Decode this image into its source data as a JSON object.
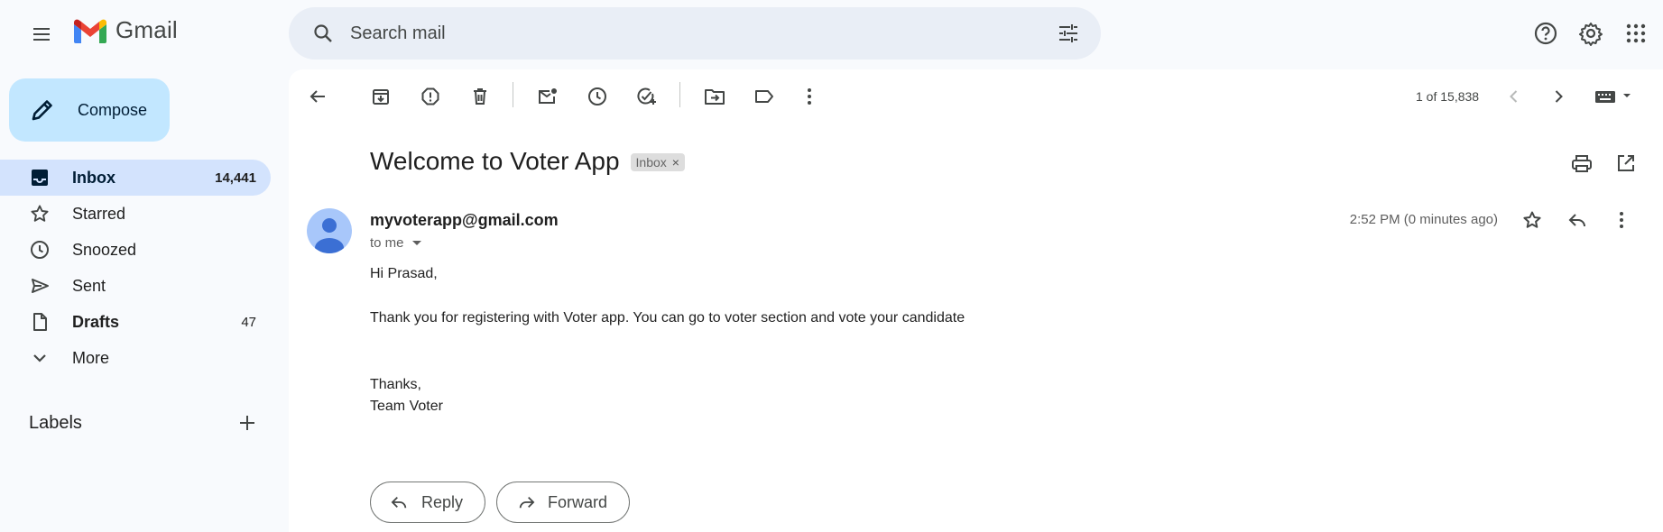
{
  "app": {
    "name": "Gmail"
  },
  "search": {
    "placeholder": "Search mail"
  },
  "compose": {
    "label": "Compose"
  },
  "sidebar": {
    "items": [
      {
        "label": "Inbox",
        "count": "14,441",
        "icon": "inbox-icon"
      },
      {
        "label": "Starred",
        "count": "",
        "icon": "star-icon"
      },
      {
        "label": "Snoozed",
        "count": "",
        "icon": "clock-icon"
      },
      {
        "label": "Sent",
        "count": "",
        "icon": "send-icon"
      },
      {
        "label": "Drafts",
        "count": "47",
        "icon": "draft-icon"
      },
      {
        "label": "More",
        "count": "",
        "icon": "chevron-down-icon"
      }
    ],
    "labels_heading": "Labels"
  },
  "toolbar": {
    "pager": "1 of 15,838"
  },
  "email": {
    "subject": "Welcome to Voter App",
    "label_chip": "Inbox",
    "label_chip_close": "×",
    "sender": "myvoterapp@gmail.com",
    "recipient": "to me",
    "timestamp": "2:52 PM (0 minutes ago)",
    "greeting": "Hi Prasad,",
    "message": "Thank you for registering with Voter app. You can go to voter section and vote your candidate",
    "signoff": "Thanks,",
    "signature": "Team Voter"
  },
  "actions": {
    "reply": "Reply",
    "forward": "Forward"
  },
  "colors": {
    "accent": "#c2e7ff",
    "active_nav": "#d3e3fd",
    "search_bg": "#e9eef6",
    "page_bg": "#f8fafd"
  }
}
